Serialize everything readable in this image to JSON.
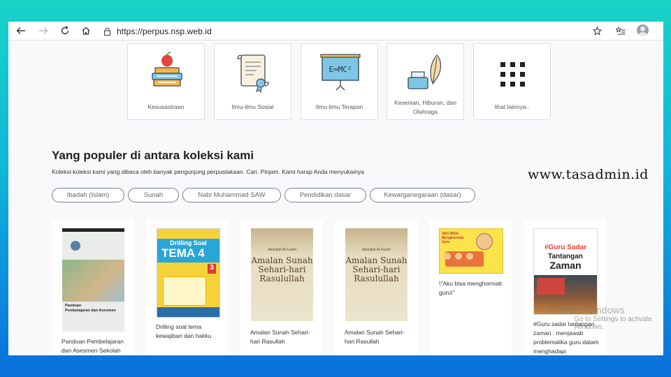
{
  "browser": {
    "url": "https://perpus.nsp.web.id",
    "icons": [
      "back-icon",
      "forward-icon",
      "reload-icon",
      "home-icon",
      "lock-icon",
      "star-icon",
      "favorites-icon",
      "profile-icon"
    ]
  },
  "categories": [
    {
      "label": "Kesusastraan",
      "icon": "books-apple-icon"
    },
    {
      "label": "Ilmu-ilmu Sosial",
      "icon": "certificate-icon"
    },
    {
      "label": "Ilmu-ilmu Terapan",
      "icon": "blackboard-icon"
    },
    {
      "label": "Kesenian, Hiburan, dan Olahraga",
      "icon": "ink-quill-icon"
    },
    {
      "label": "lihat lainnya..",
      "icon": "grid-icon"
    }
  ],
  "popular": {
    "heading": "Yang populer di antara koleksi kami",
    "subheading": "Koleksi-koleksi kami yang dibaca oleh banyak pengunjung perpustakaan. Cari. Pinjam. Kami harap Anda menyukainya",
    "tags": [
      "Ibadah (Islam)",
      "Sunah",
      "Nabi Muhammad SAW",
      "Pendidikan dasar",
      "Kewarganegaraan (dasar)"
    ]
  },
  "books": [
    {
      "title": "Panduan Pembelajaran dan Asesmen Sekolah",
      "cover_text": [
        "Panduan",
        "Pembelajaran dan Asesmen"
      ]
    },
    {
      "title": "Drilling soal tema kewajiban dan hakku",
      "cover_text": [
        "Drilling Soal",
        "TEMA 4",
        "3"
      ]
    },
    {
      "title": "Amalan Sunah Sehari-hari Rasullah",
      "cover_text": [
        "Abdullah Al-Fureih",
        "Amalan Sunah",
        "Sehari-hari",
        "Rasulullah"
      ]
    },
    {
      "title": "Amalan Sunah Sehari-hari Rasullah",
      "cover_text": [
        "Abdullah Al-Fureih",
        "Amalan Sunah",
        "Sehari-hari",
        "Rasulullah"
      ]
    },
    {
      "title": "\\\"Aku bisa menghormati guru\\\"",
      "cover_text": [
        "AKU BISA",
        "Menghormati",
        "Guru"
      ]
    },
    {
      "title": "#Guru sadar tantangan zaman : menjawab problematika guru dalam menghadapi",
      "cover_text": [
        "#Guru Sadar",
        "Tantangan",
        "Zaman"
      ]
    }
  ],
  "watermark": "www.tasadmin.id",
  "activation": {
    "line1": "Activate Windows",
    "line2": "Go to Settings to activate Windows."
  },
  "colors": {
    "bg_top": "#19d3c6",
    "bg_bottom": "#0a6fdb",
    "page_bg": "#f9f9fb"
  }
}
